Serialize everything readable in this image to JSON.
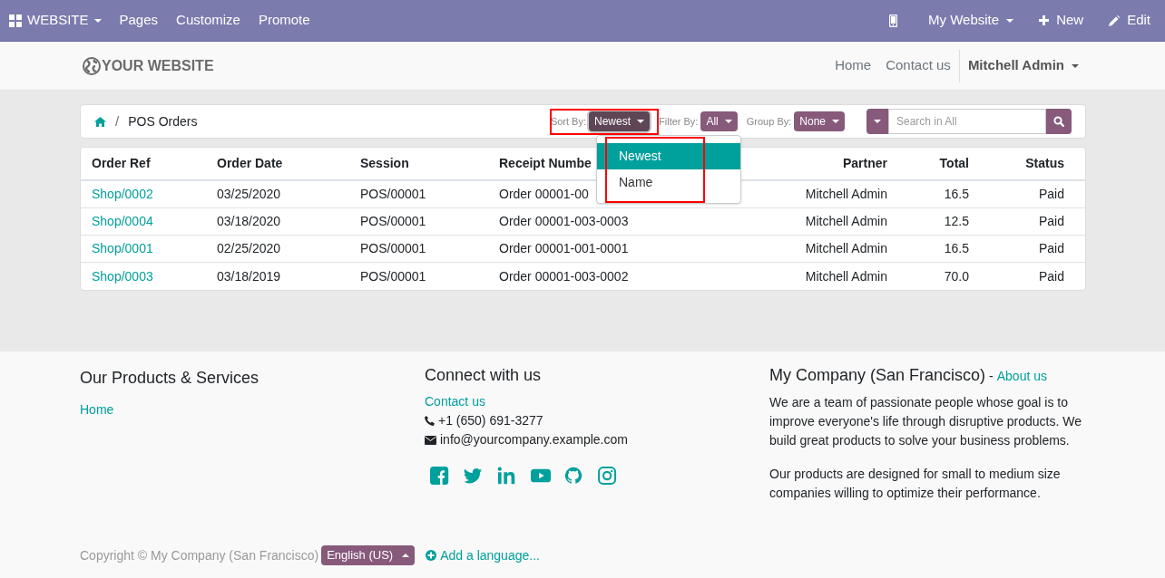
{
  "topbar": {
    "app": "WEBSITE",
    "menu": [
      "Pages",
      "Customize",
      "Promote"
    ],
    "website": "My Website",
    "new": "New",
    "edit": "Edit"
  },
  "header": {
    "logo": "YOUR WEBSITE",
    "links": [
      "Home",
      "Contact us"
    ],
    "user": "Mitchell Admin"
  },
  "breadcrumb": {
    "separator": "/",
    "page": "POS Orders"
  },
  "controls": {
    "sort_label": "Sort By:",
    "sort": "Newest",
    "filter_label": "Filter By:",
    "filter": "All",
    "group_label": "Group By:",
    "group": "None",
    "search_placeholder": "Search in All"
  },
  "sort_menu": [
    {
      "label": "Newest",
      "selected": true
    },
    {
      "label": "Name",
      "selected": false
    }
  ],
  "table": {
    "columns": [
      "Order Ref",
      "Order Date",
      "Session",
      "Receipt Numbe",
      "Partner",
      "Total",
      "Status"
    ],
    "rows": [
      [
        "Shop/0002",
        "03/25/2020",
        "POS/00001",
        "Order 00001-00",
        "Mitchell Admin",
        "16.5",
        "Paid"
      ],
      [
        "Shop/0004",
        "03/18/2020",
        "POS/00001",
        "Order 00001-003-0003",
        "Mitchell Admin",
        "12.5",
        "Paid"
      ],
      [
        "Shop/0001",
        "02/25/2020",
        "POS/00001",
        "Order 00001-001-0001",
        "Mitchell Admin",
        "16.5",
        "Paid"
      ],
      [
        "Shop/0003",
        "03/18/2019",
        "POS/00001",
        "Order 00001-003-0002",
        "Mitchell Admin",
        "70.0",
        "Paid"
      ]
    ]
  },
  "footer": {
    "col1_title": "Our Products & Services",
    "col1_link": "Home",
    "col2_title": "Connect with us",
    "col2_link": "Contact us",
    "phone": "+1 (650) 691-3277",
    "email": "info@yourcompany.example.com",
    "col3_title": "My Company (San Francisco)",
    "col3_sep": "-",
    "col3_link": "About us",
    "para1": "We are a team of passionate people whose goal is to improve everyone's life through disruptive products. We build great products to solve your business problems.",
    "para2": "Our products are designed for small to medium size companies willing to optimize their performance.",
    "copyright": "Copyright © My Company (San Francisco)",
    "language": "English (US)",
    "add_language": "Add a language..."
  }
}
